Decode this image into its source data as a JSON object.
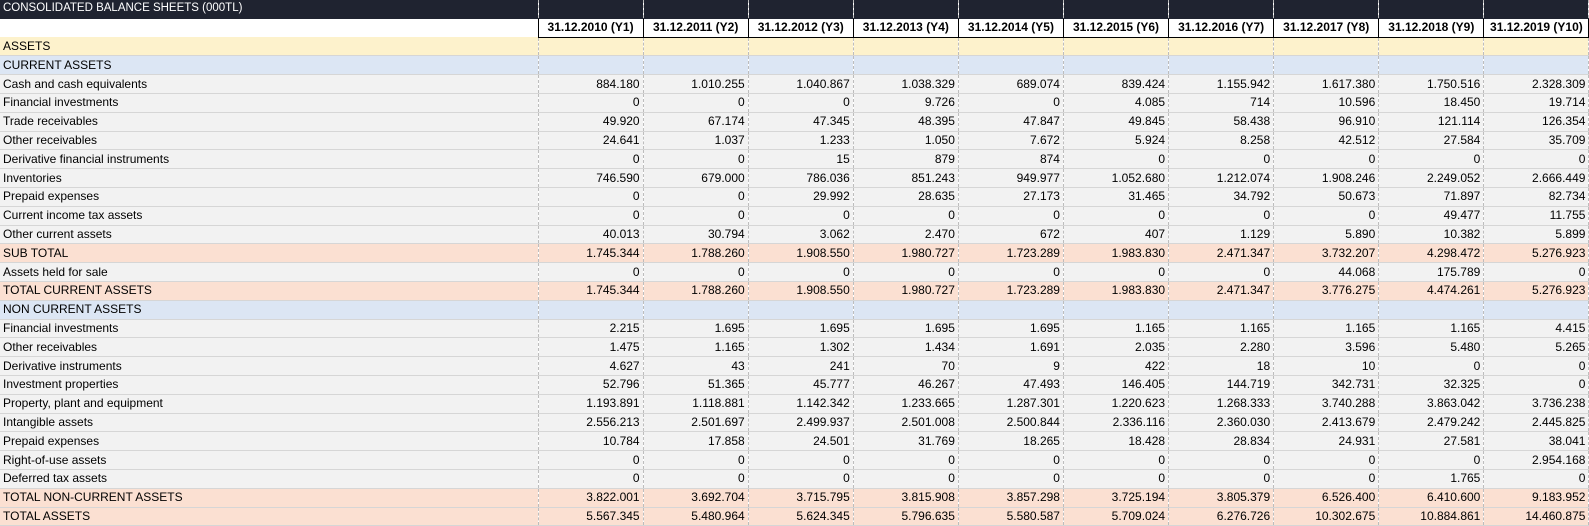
{
  "title": "CONSOLIDATED BALANCE SHEETS (000TL)",
  "periods": [
    "31.12.2010 (Y1)",
    "31.12.2011 (Y2)",
    "31.12.2012 (Y3)",
    "31.12.2013 (Y4)",
    "31.12.2014 (Y5)",
    "31.12.2015 (Y6)",
    "31.12.2016 (Y7)",
    "31.12.2017 (Y8)",
    "31.12.2018 (Y9)",
    "31.12.2019 (Y10)"
  ],
  "rows": [
    {
      "type": "assets",
      "label": "ASSETS",
      "values": []
    },
    {
      "type": "section",
      "label": "CURRENT ASSETS",
      "values": []
    },
    {
      "type": "item",
      "label": "Cash and cash equivalents",
      "values": [
        "884.180",
        "1.010.255",
        "1.040.867",
        "1.038.329",
        "689.074",
        "839.424",
        "1.155.942",
        "1.617.380",
        "1.750.516",
        "2.328.309"
      ]
    },
    {
      "type": "item",
      "label": "Financial investments",
      "values": [
        "0",
        "0",
        "0",
        "9.726",
        "0",
        "4.085",
        "714",
        "10.596",
        "18.450",
        "19.714"
      ]
    },
    {
      "type": "item",
      "label": "Trade receivables",
      "values": [
        "49.920",
        "67.174",
        "47.345",
        "48.395",
        "47.847",
        "49.845",
        "58.438",
        "96.910",
        "121.114",
        "126.354"
      ]
    },
    {
      "type": "item",
      "label": "Other receivables",
      "values": [
        "24.641",
        "1.037",
        "1.233",
        "1.050",
        "7.672",
        "5.924",
        "8.258",
        "42.512",
        "27.584",
        "35.709"
      ]
    },
    {
      "type": "item",
      "label": "Derivative financial instruments",
      "values": [
        "0",
        "0",
        "15",
        "879",
        "874",
        "0",
        "0",
        "0",
        "0",
        "0"
      ]
    },
    {
      "type": "item",
      "label": "Inventories",
      "values": [
        "746.590",
        "679.000",
        "786.036",
        "851.243",
        "949.977",
        "1.052.680",
        "1.212.074",
        "1.908.246",
        "2.249.052",
        "2.666.449"
      ]
    },
    {
      "type": "item",
      "label": "Prepaid expenses",
      "values": [
        "0",
        "0",
        "29.992",
        "28.635",
        "27.173",
        "31.465",
        "34.792",
        "50.673",
        "71.897",
        "82.734"
      ]
    },
    {
      "type": "item",
      "label": "Current income tax assets",
      "values": [
        "0",
        "0",
        "0",
        "0",
        "0",
        "0",
        "0",
        "0",
        "49.477",
        "11.755"
      ]
    },
    {
      "type": "item",
      "label": "Other current assets",
      "values": [
        "40.013",
        "30.794",
        "3.062",
        "2.470",
        "672",
        "407",
        "1.129",
        "5.890",
        "10.382",
        "5.899"
      ]
    },
    {
      "type": "subtotal",
      "label": "SUB TOTAL",
      "values": [
        "1.745.344",
        "1.788.260",
        "1.908.550",
        "1.980.727",
        "1.723.289",
        "1.983.830",
        "2.471.347",
        "3.732.207",
        "4.298.472",
        "5.276.923"
      ]
    },
    {
      "type": "item",
      "label": "Assets held for sale",
      "values": [
        "0",
        "0",
        "0",
        "0",
        "0",
        "0",
        "0",
        "44.068",
        "175.789",
        "0"
      ]
    },
    {
      "type": "total",
      "label": "TOTAL CURRENT ASSETS",
      "values": [
        "1.745.344",
        "1.788.260",
        "1.908.550",
        "1.980.727",
        "1.723.289",
        "1.983.830",
        "2.471.347",
        "3.776.275",
        "4.474.261",
        "5.276.923"
      ]
    },
    {
      "type": "section",
      "label": "NON CURRENT ASSETS",
      "values": []
    },
    {
      "type": "item",
      "label": "Financial investments",
      "values": [
        "2.215",
        "1.695",
        "1.695",
        "1.695",
        "1.695",
        "1.165",
        "1.165",
        "1.165",
        "1.165",
        "4.415"
      ]
    },
    {
      "type": "item",
      "label": "Other receivables",
      "values": [
        "1.475",
        "1.165",
        "1.302",
        "1.434",
        "1.691",
        "2.035",
        "2.280",
        "3.596",
        "5.480",
        "5.265"
      ]
    },
    {
      "type": "item",
      "label": "Derivative instruments",
      "values": [
        "4.627",
        "43",
        "241",
        "70",
        "9",
        "422",
        "18",
        "10",
        "0",
        "0"
      ]
    },
    {
      "type": "item",
      "label": "Investment properties",
      "values": [
        "52.796",
        "51.365",
        "45.777",
        "46.267",
        "47.493",
        "146.405",
        "144.719",
        "342.731",
        "32.325",
        "0"
      ]
    },
    {
      "type": "item",
      "label": "Property, plant and equipment",
      "values": [
        "1.193.891",
        "1.118.881",
        "1.142.342",
        "1.233.665",
        "1.287.301",
        "1.220.623",
        "1.268.333",
        "3.740.288",
        "3.863.042",
        "3.736.238"
      ]
    },
    {
      "type": "item",
      "label": "Intangible assets",
      "values": [
        "2.556.213",
        "2.501.697",
        "2.499.937",
        "2.501.008",
        "2.500.844",
        "2.336.116",
        "2.360.030",
        "2.413.679",
        "2.479.242",
        "2.445.825"
      ]
    },
    {
      "type": "item",
      "label": "Prepaid expenses",
      "values": [
        "10.784",
        "17.858",
        "24.501",
        "31.769",
        "18.265",
        "18.428",
        "28.834",
        "24.931",
        "27.581",
        "38.041"
      ]
    },
    {
      "type": "item",
      "label": "Right-of-use assets",
      "values": [
        "0",
        "0",
        "0",
        "0",
        "0",
        "0",
        "0",
        "0",
        "0",
        "2.954.168"
      ]
    },
    {
      "type": "item",
      "label": "Deferred tax assets",
      "values": [
        "0",
        "0",
        "0",
        "0",
        "0",
        "0",
        "0",
        "0",
        "1.765",
        "0"
      ]
    },
    {
      "type": "total",
      "label": "TOTAL NON-CURRENT ASSETS",
      "values": [
        "3.822.001",
        "3.692.704",
        "3.715.795",
        "3.815.908",
        "3.857.298",
        "3.725.194",
        "3.805.379",
        "6.526.400",
        "6.410.600",
        "9.183.952"
      ]
    },
    {
      "type": "total",
      "label": "TOTAL ASSETS",
      "values": [
        "5.567.345",
        "5.480.964",
        "5.624.345",
        "5.796.635",
        "5.580.587",
        "5.709.024",
        "6.276.726",
        "10.302.675",
        "10.884.861",
        "14.460.875"
      ]
    }
  ]
}
